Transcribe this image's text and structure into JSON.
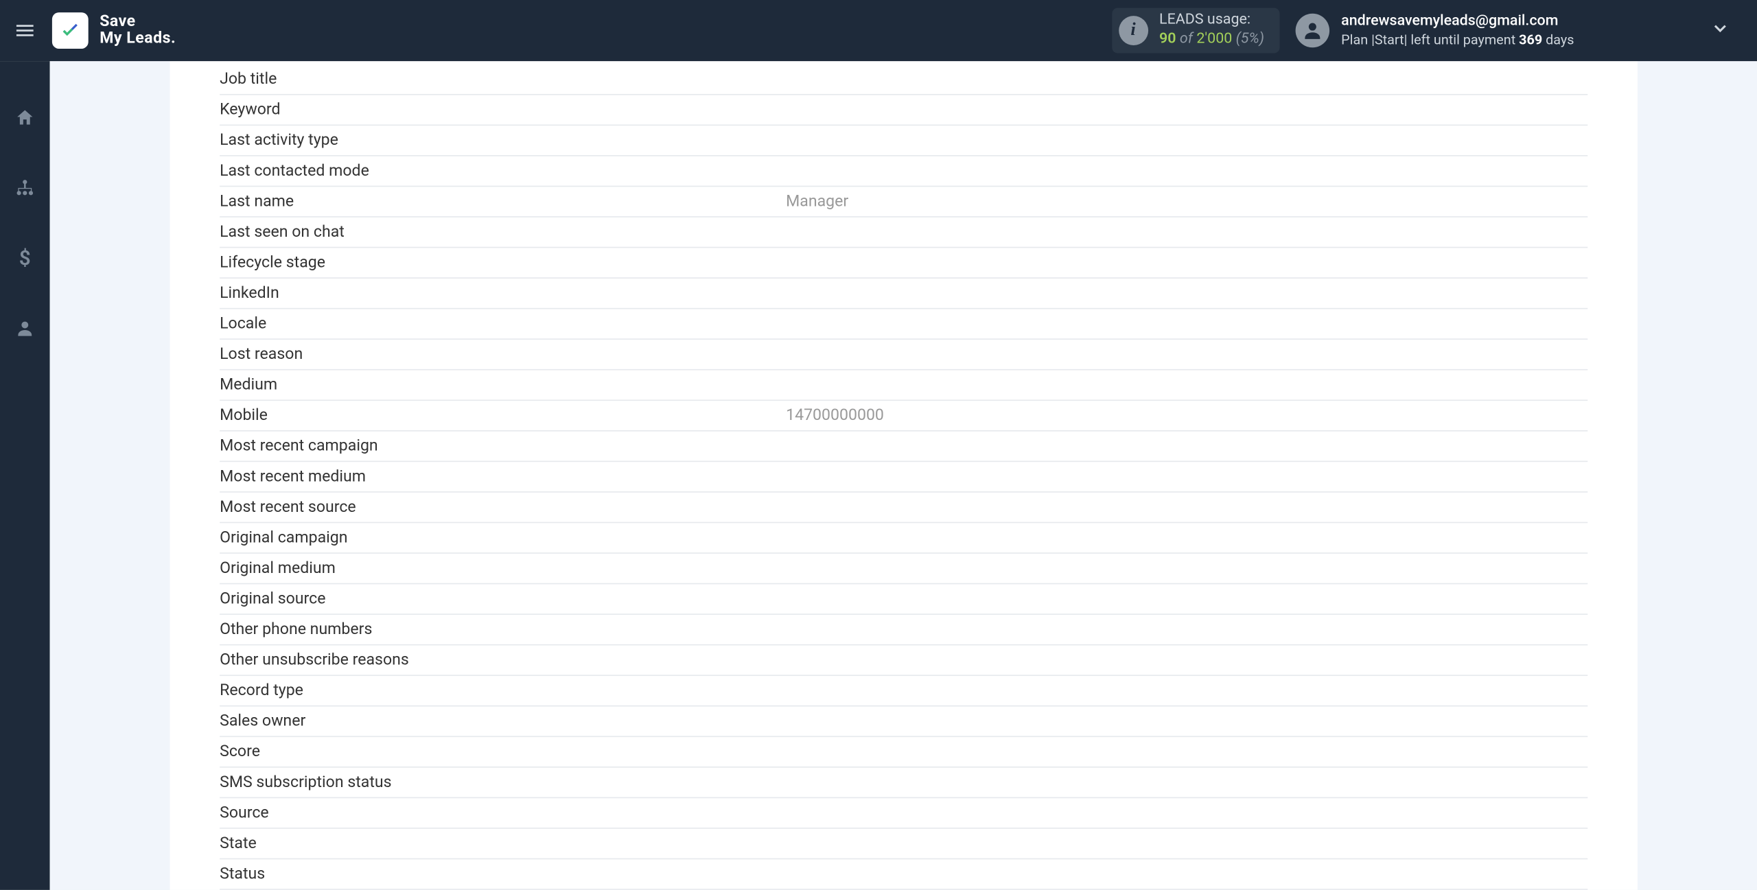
{
  "brand": {
    "line1": "Save",
    "line2": "My Leads."
  },
  "usage": {
    "label": "LEADS usage:",
    "used": "90",
    "of": "of",
    "total": "2'000",
    "pct": "(5%)"
  },
  "account": {
    "email": "andrewsavemyleads@gmail.com",
    "plan_prefix": "Plan ",
    "plan_name": "|Start|",
    "plan_mid": " left until payment ",
    "days": "369",
    "days_suffix": " days"
  },
  "fields": [
    {
      "label": "Job title",
      "value": ""
    },
    {
      "label": "Keyword",
      "value": ""
    },
    {
      "label": "Last activity type",
      "value": ""
    },
    {
      "label": "Last contacted mode",
      "value": ""
    },
    {
      "label": "Last name",
      "value": "Manager"
    },
    {
      "label": "Last seen on chat",
      "value": ""
    },
    {
      "label": "Lifecycle stage",
      "value": ""
    },
    {
      "label": "LinkedIn",
      "value": ""
    },
    {
      "label": "Locale",
      "value": ""
    },
    {
      "label": "Lost reason",
      "value": ""
    },
    {
      "label": "Medium",
      "value": ""
    },
    {
      "label": "Mobile",
      "value": "14700000000"
    },
    {
      "label": "Most recent campaign",
      "value": ""
    },
    {
      "label": "Most recent medium",
      "value": ""
    },
    {
      "label": "Most recent source",
      "value": ""
    },
    {
      "label": "Original campaign",
      "value": ""
    },
    {
      "label": "Original medium",
      "value": ""
    },
    {
      "label": "Original source",
      "value": ""
    },
    {
      "label": "Other phone numbers",
      "value": ""
    },
    {
      "label": "Other unsubscribe reasons",
      "value": ""
    },
    {
      "label": "Record type",
      "value": ""
    },
    {
      "label": "Sales owner",
      "value": ""
    },
    {
      "label": "Score",
      "value": ""
    },
    {
      "label": "SMS subscription status",
      "value": ""
    },
    {
      "label": "Source",
      "value": ""
    },
    {
      "label": "State",
      "value": ""
    },
    {
      "label": "Status",
      "value": ""
    }
  ]
}
